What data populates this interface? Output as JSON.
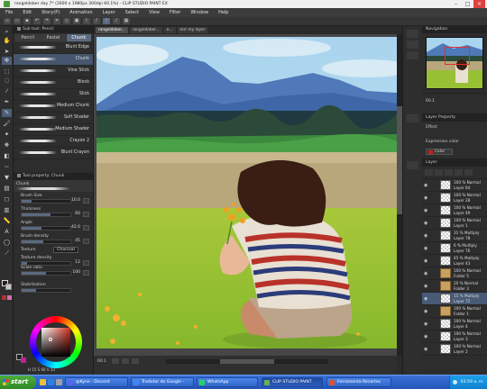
{
  "window": {
    "title": "rangeldober day 7* (2600 x 1980px 300dpi 60.1%) - CLIP STUDIO PAINT EX"
  },
  "menu": [
    "File",
    "Edit",
    "Story(P)",
    "Animation",
    "Layer",
    "Select",
    "View",
    "Filter",
    "Window",
    "Help"
  ],
  "brush_panel": {
    "title": "Sub tool: Pencil",
    "tabs": [
      "Pencil",
      "Pastel",
      "Chunk"
    ],
    "selected_tab": "Chunk",
    "brushes": [
      "Blunt Edge",
      "Chunk",
      "Vine Stick",
      "Block",
      "Slick",
      "Medium Chunk",
      "Soft Shader",
      "Medium Shader",
      "Crayon 2",
      "Blunt Crayon"
    ],
    "selected_brush": "Chunk"
  },
  "tool_property": {
    "title": "Tool property: Chunk",
    "brush_name": "Chunk",
    "rows": [
      {
        "label": "Brush Size",
        "value": "10.0",
        "fill": 0.2
      },
      {
        "label": "Thickness",
        "value": "60",
        "fill": 0.6
      },
      {
        "label": "Angle",
        "value": "42.0",
        "fill": 0.4
      },
      {
        "label": "Brush density",
        "value": "45",
        "fill": 0.45
      }
    ],
    "texture_label": "Texture",
    "texture_value": "Charcoal",
    "texture_density": {
      "label": "Texture density",
      "value": "12",
      "fill": 0.12
    },
    "scale_ratio": {
      "label": "Scale ratio",
      "value": "100",
      "fill": 0.5
    },
    "stabilization": {
      "label": "Stabilization",
      "value": "",
      "fill": 0.3
    }
  },
  "color_panel": {
    "hsv_text": "H 15 S 60 V 33"
  },
  "document_tabs": [
    "rangeldober...",
    "rangeldober...",
    "e...",
    "mrr my layer"
  ],
  "canvas_status": {
    "zoom": "60.1"
  },
  "navigator": {
    "title": "Navigation"
  },
  "navigator_zoom": "60.1",
  "layer_property": {
    "title": "Layer Property",
    "effect_label": "Effect",
    "expression_label": "Expression color",
    "color_value": "Color"
  },
  "layer_panel": {
    "title": "Layer",
    "layers": [
      {
        "l1": "100 % Normal",
        "l2": "Layer 64",
        "folder": false,
        "selected": false
      },
      {
        "l1": "100 % Normal",
        "l2": "Layer 28",
        "folder": false,
        "selected": false
      },
      {
        "l1": "100 % Normal",
        "l2": "Layer 49",
        "folder": false,
        "selected": false
      },
      {
        "l1": "100 % Normal",
        "l2": "Layer 1",
        "folder": false,
        "selected": false
      },
      {
        "l1": "31 % Multiply",
        "l2": "Layer 78",
        "folder": false,
        "selected": false
      },
      {
        "l1": "6 % Multiply",
        "l2": "Layer 76",
        "folder": false,
        "selected": false
      },
      {
        "l1": "45 % Multiply",
        "l2": "Layer 43",
        "folder": false,
        "selected": false
      },
      {
        "l1": "100 % Normal",
        "l2": "Folder 5",
        "folder": true,
        "selected": false
      },
      {
        "l1": "20 % Normal",
        "l2": "Folder 3",
        "folder": true,
        "selected": false
      },
      {
        "l1": "15 % Multiply",
        "l2": "Layer 72",
        "folder": false,
        "selected": true
      },
      {
        "l1": "100 % Normal",
        "l2": "Folder 1",
        "folder": true,
        "selected": false
      },
      {
        "l1": "100 % Normal",
        "l2": "Layer 4",
        "folder": false,
        "selected": false
      },
      {
        "l1": "100 % Normal",
        "l2": "Layer 3",
        "folder": false,
        "selected": false
      },
      {
        "l1": "100 % Normal",
        "l2": "Layer 2",
        "folder": false,
        "selected": false
      }
    ]
  },
  "taskbar": {
    "start": "start",
    "items": [
      {
        "label": "@Kyne - Discord",
        "color": "#5865f2"
      },
      {
        "label": "Tradutor do Google -",
        "color": "#4285f4"
      },
      {
        "label": "WhatsApp",
        "color": "#25d366"
      },
      {
        "label": "CLIP STUDIO PAINT",
        "color": "#6ab04c"
      },
      {
        "label": "Ferramenta Recortes",
        "color": "#e05030"
      }
    ],
    "clock": "03:59 a. m."
  }
}
